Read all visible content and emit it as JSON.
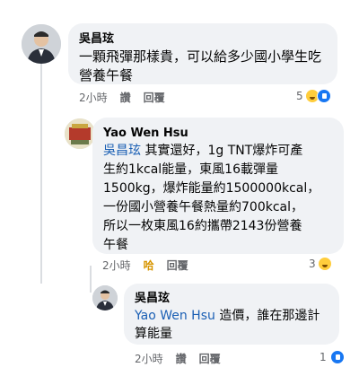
{
  "comments": [
    {
      "author": "吳昌玹",
      "lines": [
        "一顆飛彈那樣貴，可以給多少國小學生吃",
        "營養午餐"
      ],
      "time": "2小時",
      "like_label": "讚",
      "reply_label": "回覆",
      "reaction_count": "5"
    },
    {
      "author": "Yao Wen Hsu",
      "tag": "吳昌玹",
      "lines": [
        " 其實還好，1g TNT爆炸可產",
        "生約1kcal能量，東風16載彈量",
        "1500kg，爆炸能量約1500000kcal，",
        "一份國小營養午餐熱量約700kcal，",
        "所以一枚東風16約攜帶2143份營養",
        "午餐"
      ],
      "time": "2小時",
      "like_label": "哈",
      "reply_label": "回覆",
      "reaction_count": "3"
    },
    {
      "author": "吳昌玹",
      "tag": "Yao Wen Hsu",
      "lines": [
        " 造價，誰在那邊計",
        "算能量"
      ],
      "time": "2小時",
      "like_label": "讚",
      "reply_label": "回覆",
      "reaction_count": "1"
    }
  ]
}
